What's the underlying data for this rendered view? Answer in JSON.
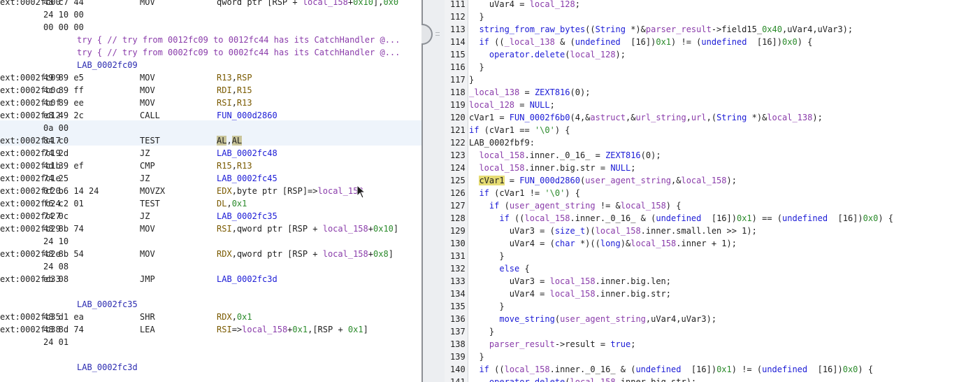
{
  "listing": {
    "rows": [
      {
        "addr": "ext:0002fc00",
        "bytes": "48 c7 44",
        "mnem": "MOV",
        "ops": "qword ptr [RSP + local_158+0x10],0x0"
      },
      {
        "addr": "",
        "bytes": "24 10 00",
        "mnem": "",
        "ops": ""
      },
      {
        "addr": "",
        "bytes": "00 00 00",
        "mnem": "",
        "ops": ""
      },
      {
        "comment": "try { // try from 0012fc09 to 0012fc44 has its CatchHandler @..."
      },
      {
        "comment": "try { // try from 0002fc09 to 0002fc44 has its CatchHandler @..."
      },
      {
        "label": "LAB_0002fc09"
      },
      {
        "addr": "ext:0002fc09",
        "bytes": "49 89 e5",
        "mnem": "MOV",
        "ops": "R13,RSP"
      },
      {
        "addr": "ext:0002fc0c",
        "bytes": "4c 89 ff",
        "mnem": "MOV",
        "ops": "RDI,R15"
      },
      {
        "addr": "ext:0002fc0f",
        "bytes": "4c 89 ee",
        "mnem": "MOV",
        "ops": "RSI,R13"
      },
      {
        "addr": "ext:0002fc12",
        "bytes": "e8 49 2c",
        "mnem": "CALL",
        "ops": "FUN_000d2860"
      },
      {
        "addr": "",
        "bytes": "0a 00",
        "mnem": "",
        "ops": ""
      },
      {
        "addr": "ext:0002fc17",
        "bytes": "84 c0",
        "mnem": "TEST",
        "ops": "AL,AL"
      },
      {
        "addr": "ext:0002fc19",
        "bytes": "74 2d",
        "mnem": "JZ",
        "ops": "LAB_0002fc48"
      },
      {
        "addr": "ext:0002fc1b",
        "bytes": "4d 39 ef",
        "mnem": "CMP",
        "ops": "R15,R13"
      },
      {
        "addr": "ext:0002fc1e",
        "bytes": "74 25",
        "mnem": "JZ",
        "ops": "LAB_0002fc45"
      },
      {
        "addr": "ext:0002fc20",
        "bytes": "0f b6 14 24",
        "mnem": "MOVZX",
        "ops": "EDX,byte ptr [RSP]=>local_158"
      },
      {
        "addr": "ext:0002fc24",
        "bytes": "f6 c2 01",
        "mnem": "TEST",
        "ops": "DL,0x1"
      },
      {
        "addr": "ext:0002fc27",
        "bytes": "74 0c",
        "mnem": "JZ",
        "ops": "LAB_0002fc35"
      },
      {
        "addr": "ext:0002fc29",
        "bytes": "48 8b 74",
        "mnem": "MOV",
        "ops": "RSI,qword ptr [RSP + local_158+0x10]"
      },
      {
        "addr": "",
        "bytes": "24 10",
        "mnem": "",
        "ops": ""
      },
      {
        "addr": "ext:0002fc2e",
        "bytes": "48 8b 54",
        "mnem": "MOV",
        "ops": "RDX,qword ptr [RSP + local_158+0x8]"
      },
      {
        "addr": "",
        "bytes": "24 08",
        "mnem": "",
        "ops": ""
      },
      {
        "addr": "ext:0002fc33",
        "bytes": "eb 08",
        "mnem": "JMP",
        "ops": "LAB_0002fc3d"
      },
      {
        "blank": true
      },
      {
        "label": "LAB_0002fc35"
      },
      {
        "addr": "ext:0002fc35",
        "bytes": "48 d1 ea",
        "mnem": "SHR",
        "ops": "RDX,0x1"
      },
      {
        "addr": "ext:0002fc38",
        "bytes": "48 8d 74",
        "mnem": "LEA",
        "ops": "RSI=>local_158+0x1,[RSP + 0x1]"
      },
      {
        "addr": "",
        "bytes": "24 01",
        "mnem": "",
        "ops": ""
      },
      {
        "blank": true
      },
      {
        "label": "LAB_0002fc3d"
      }
    ]
  },
  "decompile": {
    "lines": [
      {
        "n": "111",
        "t": "    uVar4 = local_128;"
      },
      {
        "n": "112",
        "t": "  }"
      },
      {
        "n": "113",
        "t": "  string_from_raw_bytes((String *)&parser_result->field15_0x40,uVar4,uVar3);"
      },
      {
        "n": "114",
        "t": "  if ((_local_138 & (undefined  [16])0x1) != (undefined  [16])0x0) {"
      },
      {
        "n": "115",
        "t": "    operator.delete(local_128);"
      },
      {
        "n": "116",
        "t": "  }"
      },
      {
        "n": "117",
        "t": "}"
      },
      {
        "n": "118",
        "t": "_local_138 = ZEXT816(0);"
      },
      {
        "n": "119",
        "t": "local_128 = NULL;"
      },
      {
        "n": "120",
        "t": "cVar1 = FUN_0002f6b0(4,&astruct,&url_string,url,(String *)&local_138);"
      },
      {
        "n": "121",
        "t": "if (cVar1 == '\\0') {"
      },
      {
        "n": "122",
        "t": "LAB_0002fbf9:"
      },
      {
        "n": "123",
        "t": "  local_158.inner._0_16_ = ZEXT816(0);"
      },
      {
        "n": "124",
        "t": "  local_158.inner.big.str = NULL;"
      },
      {
        "n": "125",
        "t": "  cVar1 = FUN_000d2860(user_agent_string,&local_158);"
      },
      {
        "n": "126",
        "t": "  if (cVar1 != '\\0') {"
      },
      {
        "n": "127",
        "t": "    if (user_agent_string != &local_158) {"
      },
      {
        "n": "128",
        "t": "      if ((local_158.inner._0_16_ & (undefined  [16])0x1) == (undefined  [16])0x0) {"
      },
      {
        "n": "129",
        "t": "        uVar3 = (size_t)(local_158.inner.small.len >> 1);"
      },
      {
        "n": "130",
        "t": "        uVar4 = (char *)((long)&local_158.inner + 1);"
      },
      {
        "n": "131",
        "t": "      }"
      },
      {
        "n": "132",
        "t": "      else {"
      },
      {
        "n": "133",
        "t": "        uVar3 = local_158.inner.big.len;"
      },
      {
        "n": "134",
        "t": "        uVar4 = local_158.inner.big.str;"
      },
      {
        "n": "135",
        "t": "      }"
      },
      {
        "n": "136",
        "t": "      move_string(user_agent_string,uVar4,uVar3);"
      },
      {
        "n": "137",
        "t": "    }"
      },
      {
        "n": "138",
        "t": "    parser_result->result = true;"
      },
      {
        "n": "139",
        "t": "  }"
      },
      {
        "n": "140",
        "t": "  if ((local_158.inner._0_16_ & (undefined  [16])0x1) != (undefined  [16])0x0) {"
      },
      {
        "n": "141",
        "t": "    operator.delete(local_158.inner.big.str);"
      }
    ]
  }
}
